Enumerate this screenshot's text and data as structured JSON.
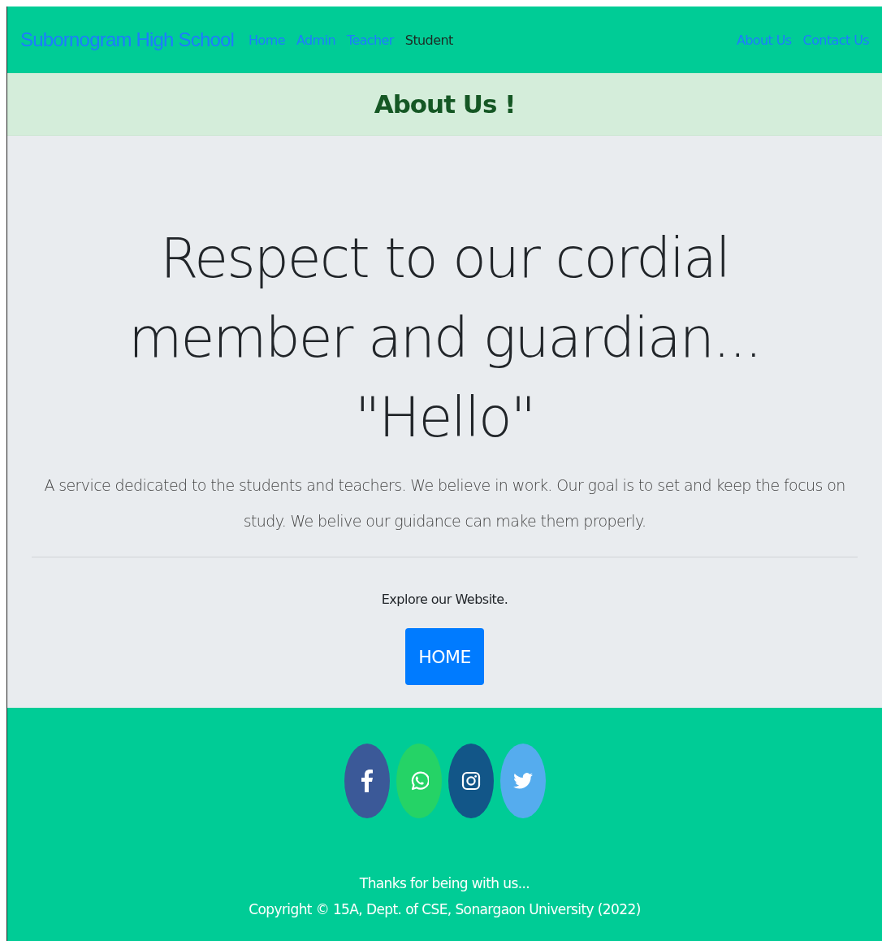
{
  "navbar": {
    "brand": "Subornogram High School",
    "links": [
      {
        "label": "Home",
        "selected": false
      },
      {
        "label": "Admin",
        "selected": false
      },
      {
        "label": "Teacher",
        "selected": false
      },
      {
        "label": "Student",
        "selected": true
      }
    ],
    "right_links": [
      {
        "label": "About Us"
      },
      {
        "label": "Contact Us"
      }
    ]
  },
  "banner": {
    "title": "About Us !"
  },
  "hero": {
    "heading": "Respect to our cordial member and guardian... \"Hello\"",
    "lead": "A service dedicated to the students and teachers. We believe in work. Our goal is to set and keep the focus on study. We belive our guidance can make them properly.",
    "prompt": "Explore our Website.",
    "button": "HOME"
  },
  "footer": {
    "social": [
      {
        "kind": "facebook",
        "color": "#3b5998"
      },
      {
        "kind": "whatsapp",
        "color": "#25d366"
      },
      {
        "kind": "instagram",
        "color": "#125688"
      },
      {
        "kind": "twitter",
        "color": "#55acee"
      }
    ],
    "thanks": "Thanks for being with us...",
    "copyright": "Copyright © 15A, Dept. of CSE, Sonargaon University (2022)"
  }
}
